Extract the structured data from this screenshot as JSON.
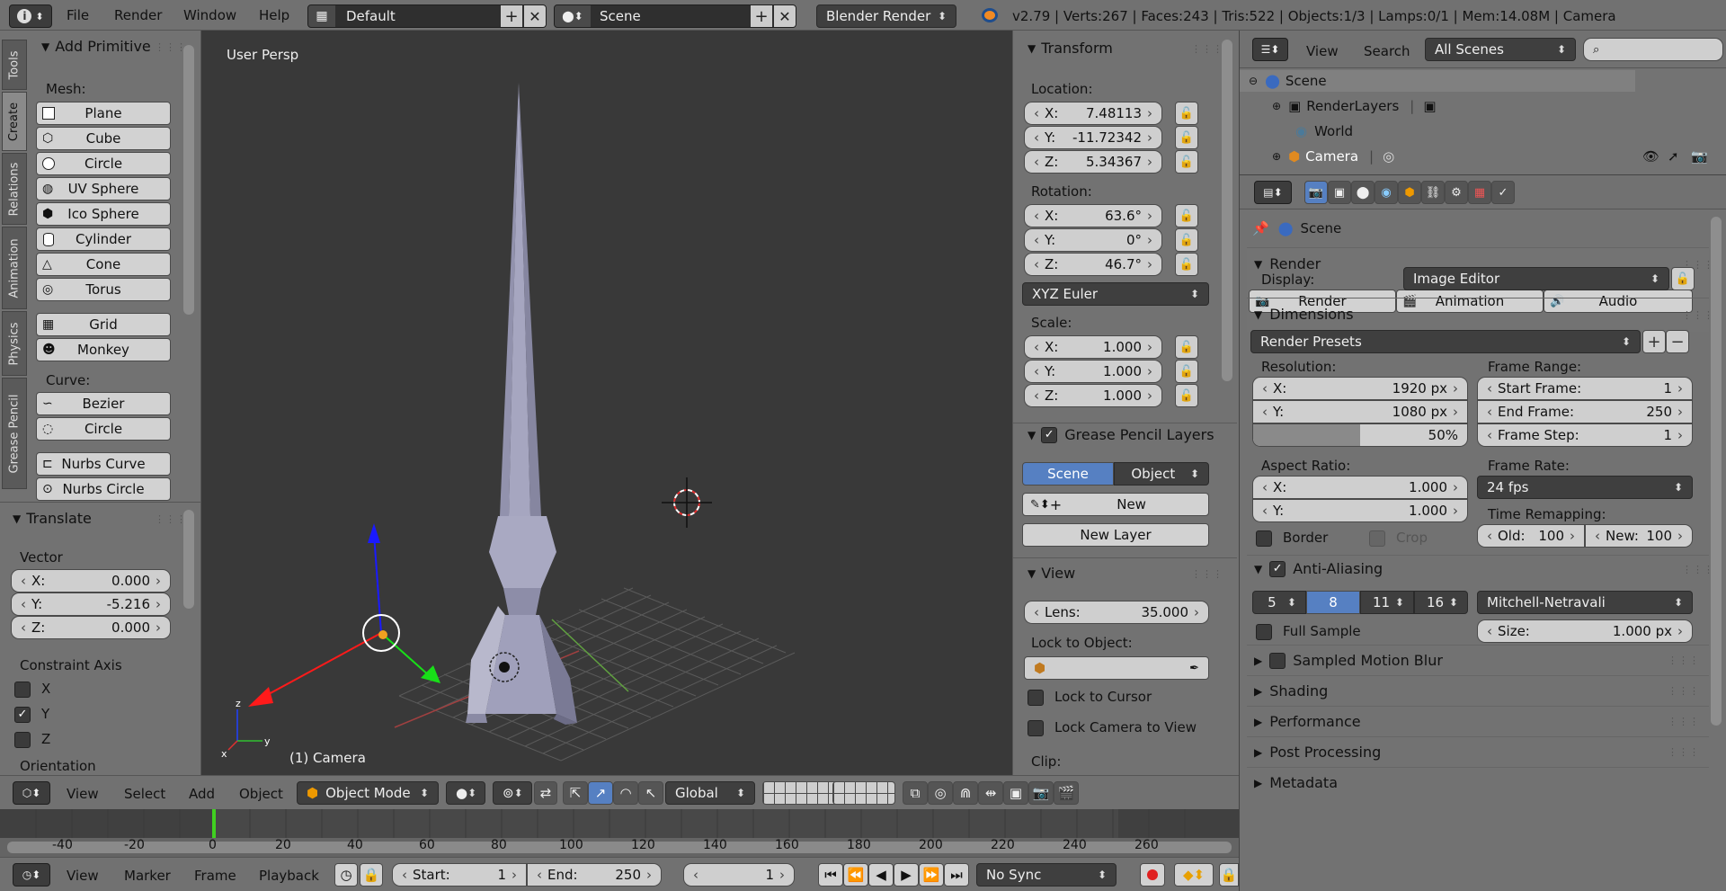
{
  "topbar": {
    "menus": [
      "File",
      "Render",
      "Window",
      "Help"
    ],
    "screen_layout": "Default",
    "scene": "Scene",
    "engine": "Blender Render",
    "stats": "v2.79 | Verts:267 | Faces:243 | Tris:522 | Objects:1/3 | Lamps:0/1 | Mem:14.08M | Camera"
  },
  "tools": {
    "tabs": [
      "Tools",
      "Create",
      "Relations",
      "Animation",
      "Physics",
      "Grease Pencil"
    ],
    "panel_title": "Add Primitive",
    "mesh_label": "Mesh:",
    "mesh": [
      "Plane",
      "Cube",
      "Circle",
      "UV Sphere",
      "Ico Sphere",
      "Cylinder",
      "Cone",
      "Torus",
      "Grid",
      "Monkey"
    ],
    "curve_label": "Curve:",
    "curve": [
      "Bezier",
      "Circle",
      "Nurbs Curve",
      "Nurbs Circle"
    ]
  },
  "translate": {
    "title": "Translate",
    "vector_label": "Vector",
    "x_label": "X:",
    "x": "0.000",
    "y_label": "Y:",
    "y": "-5.216",
    "z_label": "Z:",
    "z": "0.000",
    "axis_label": "Constraint Axis",
    "axis_x": "X",
    "axis_y": "Y",
    "axis_z": "Z",
    "orientation_label": "Orientation"
  },
  "viewport": {
    "label": "User Persp",
    "object_label": "(1) Camera",
    "colors": {
      "bg": "#393939",
      "x_axis": "#e03030",
      "y_axis": "#30c030",
      "z_axis": "#2040ff"
    }
  },
  "transform": {
    "title": "Transform",
    "location_label": "Location:",
    "loc_x": "7.48113",
    "loc_y": "-11.72342",
    "loc_z": "5.34367",
    "rotation_label": "Rotation:",
    "rot_x": "63.6°",
    "rot_y": "0°",
    "rot_z": "46.7°",
    "rot_mode": "XYZ Euler",
    "scale_label": "Scale:",
    "scale_x": "1.000",
    "scale_y": "1.000",
    "scale_z": "1.000",
    "x": "X:",
    "y": "Y:",
    "z": "Z:"
  },
  "grease": {
    "title": "Grease Pencil Layers",
    "scene": "Scene",
    "object": "Object",
    "new": "New",
    "new_layer": "New Layer"
  },
  "view": {
    "title": "View",
    "lens_label": "Lens:",
    "lens": "35.000",
    "lock_object_label": "Lock to Object:",
    "lock_cursor": "Lock to Cursor",
    "lock_camera": "Lock Camera to View",
    "clip_label": "Clip:"
  },
  "outliner": {
    "menus": [
      "View",
      "Search"
    ],
    "filter": "All Scenes",
    "items": [
      "Scene",
      "RenderLayers",
      "World",
      "Camera"
    ]
  },
  "properties": {
    "context": "Scene",
    "render": {
      "title": "Render",
      "render_btn": "Render",
      "animation_btn": "Animation",
      "audio_btn": "Audio",
      "display_label": "Display:",
      "display": "Image Editor"
    },
    "dimensions": {
      "title": "Dimensions",
      "presets": "Render Presets",
      "resolution_label": "Resolution:",
      "res_x": "1920 px",
      "res_y": "1080 px",
      "res_pct": "50%",
      "res_pct_value": 0.5,
      "frame_range_label": "Frame Range:",
      "start_label": "Start Frame:",
      "start": "1",
      "end_label": "End Frame:",
      "end": "250",
      "step_label": "Frame Step:",
      "step": "1",
      "aspect_label": "Aspect Ratio:",
      "asp_x": "1.000",
      "asp_y": "1.000",
      "frame_rate_label": "Frame Rate:",
      "fps": "24 fps",
      "remap_label": "Time Remapping:",
      "old_label": "Old:",
      "old": "100",
      "new_label": "New:",
      "new": "100",
      "border": "Border",
      "crop": "Crop",
      "x": "X:",
      "y": "Y:"
    },
    "aa": {
      "title": "Anti-Aliasing",
      "samples": [
        "5",
        "8",
        "11",
        "16"
      ],
      "filter": "Mitchell-Netravali",
      "full_sample": "Full Sample",
      "size_label": "Size:",
      "size": "1.000 px"
    },
    "collapsed": [
      "Sampled Motion Blur",
      "Shading",
      "Performance",
      "Post Processing",
      "Metadata"
    ]
  },
  "view3d_header": {
    "menus": [
      "View",
      "Select",
      "Add",
      "Object"
    ],
    "mode": "Object Mode",
    "orientation": "Global"
  },
  "timeline": {
    "ticks": [
      "-40",
      "-20",
      "0",
      "20",
      "40",
      "60",
      "80",
      "100",
      "120",
      "140",
      "160",
      "180",
      "200",
      "220",
      "240",
      "260"
    ],
    "menus": [
      "View",
      "Marker",
      "Frame",
      "Playback"
    ],
    "start_label": "Start:",
    "start": "1",
    "end_label": "End:",
    "end": "250",
    "current": "1",
    "sync": "No Sync"
  }
}
